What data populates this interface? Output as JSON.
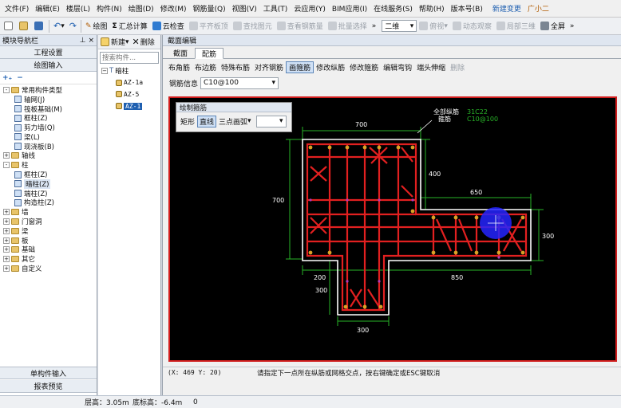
{
  "menu": {
    "items": [
      "文件(F)",
      "编辑(E)",
      "楼层(L)",
      "构件(N)",
      "绘图(D)",
      "修改(M)",
      "钢筋量(Q)",
      "视图(V)",
      "工具(T)",
      "云应用(Y)",
      "BIM应用(I)",
      "在线服务(S)",
      "帮助(H)",
      "版本号(B)",
      "新建变更",
      "广小二"
    ]
  },
  "toolbar": {
    "draw": "绘图",
    "sum": "汇总计算",
    "cloud_check": "云检查",
    "flat_slab": "平齐板顶",
    "find_element": "查找图元",
    "view_rebar": "查看钢筋量",
    "batch_select": "批量选择",
    "view_mode": "二维",
    "perspective": "俯视",
    "dynamic_view": "动态观察",
    "local_3d": "局部三维",
    "fullscreen": "全屏"
  },
  "left_panel": {
    "title": "模块导航栏",
    "pin": "⊥ ×",
    "project_settings": "工程设置",
    "draw_input": "绘图输入",
    "tree": [
      {
        "label": "常用构件类型",
        "level": 0,
        "expand": "-",
        "icon": "folder"
      },
      {
        "label": "轴网(J)",
        "level": 1,
        "icon": "axis"
      },
      {
        "label": "筏板基础(M)",
        "level": 1,
        "icon": "raft"
      },
      {
        "label": "框柱(Z)",
        "level": 1,
        "icon": "column"
      },
      {
        "label": "剪力墙(Q)",
        "level": 1,
        "icon": "wall"
      },
      {
        "label": "梁(L)",
        "level": 1,
        "icon": "beam"
      },
      {
        "label": "现浇板(B)",
        "level": 1,
        "icon": "slab"
      },
      {
        "label": "轴线",
        "level": 0,
        "expand": "+",
        "icon": "folder"
      },
      {
        "label": "柱",
        "level": 0,
        "expand": "-",
        "icon": "folder"
      },
      {
        "label": "框柱(Z)",
        "level": 1,
        "icon": "column"
      },
      {
        "label": "暗柱(Z)",
        "level": 1,
        "icon": "column",
        "selected": true
      },
      {
        "label": "端柱(Z)",
        "level": 1,
        "icon": "column"
      },
      {
        "label": "构造柱(Z)",
        "level": 1,
        "icon": "column"
      },
      {
        "label": "墙",
        "level": 0,
        "expand": "+",
        "icon": "folder"
      },
      {
        "label": "门窗洞",
        "level": 0,
        "expand": "+",
        "icon": "folder"
      },
      {
        "label": "梁",
        "level": 0,
        "expand": "+",
        "icon": "folder"
      },
      {
        "label": "板",
        "level": 0,
        "expand": "+",
        "icon": "folder"
      },
      {
        "label": "基础",
        "level": 0,
        "expand": "+",
        "icon": "folder"
      },
      {
        "label": "其它",
        "level": 0,
        "expand": "+",
        "icon": "folder"
      },
      {
        "label": "自定义",
        "level": 0,
        "expand": "+",
        "icon": "folder"
      }
    ],
    "single_input": "单构件输入",
    "report_preview": "报表预览"
  },
  "mid_panel": {
    "new": "新建",
    "delete": "删除",
    "search_placeholder": "搜索构件...",
    "root": "暗柱",
    "items": [
      "AZ-1a",
      "AZ-5",
      "AZ-1"
    ]
  },
  "main_window": {
    "title": "截面编辑",
    "tabs": [
      "截面",
      "配筋"
    ],
    "subtools": [
      "布角筋",
      "布边筋",
      "特殊布筋",
      "对齐钢筋",
      "画箍筋",
      "修改纵筋",
      "修改箍筋",
      "编辑弯钩",
      "端头伸缩",
      "删除"
    ],
    "active_subtool": "画箍筋",
    "rebar_label": "钢筋信息",
    "rebar_value": "C10@100",
    "status_coords": "(X: 469 Y: 20)",
    "status_hint": "请指定下一点所在纵筋或网格交点，按右键确定或ESC键取消"
  },
  "draw_panel": {
    "title": "绘制箍筋",
    "rect": "矩形",
    "line": "直线",
    "arc": "三点画弧"
  },
  "drawing": {
    "labels": {
      "all_long": "全部纵筋",
      "stirrup": "箍筋",
      "long_spec": "31C22",
      "stirrup_spec": "C10@100"
    },
    "dims": {
      "top": "700",
      "left": "700",
      "inner400": "400",
      "right650": "650",
      "right300": "300",
      "bot200": "200",
      "bot850": "850",
      "lower300": "300",
      "bottom300": "300"
    }
  },
  "bottom_bar": {
    "floor_height": "层高：3.05m",
    "bottom_elev": "底标高：-6.4m",
    "extra": "0"
  }
}
